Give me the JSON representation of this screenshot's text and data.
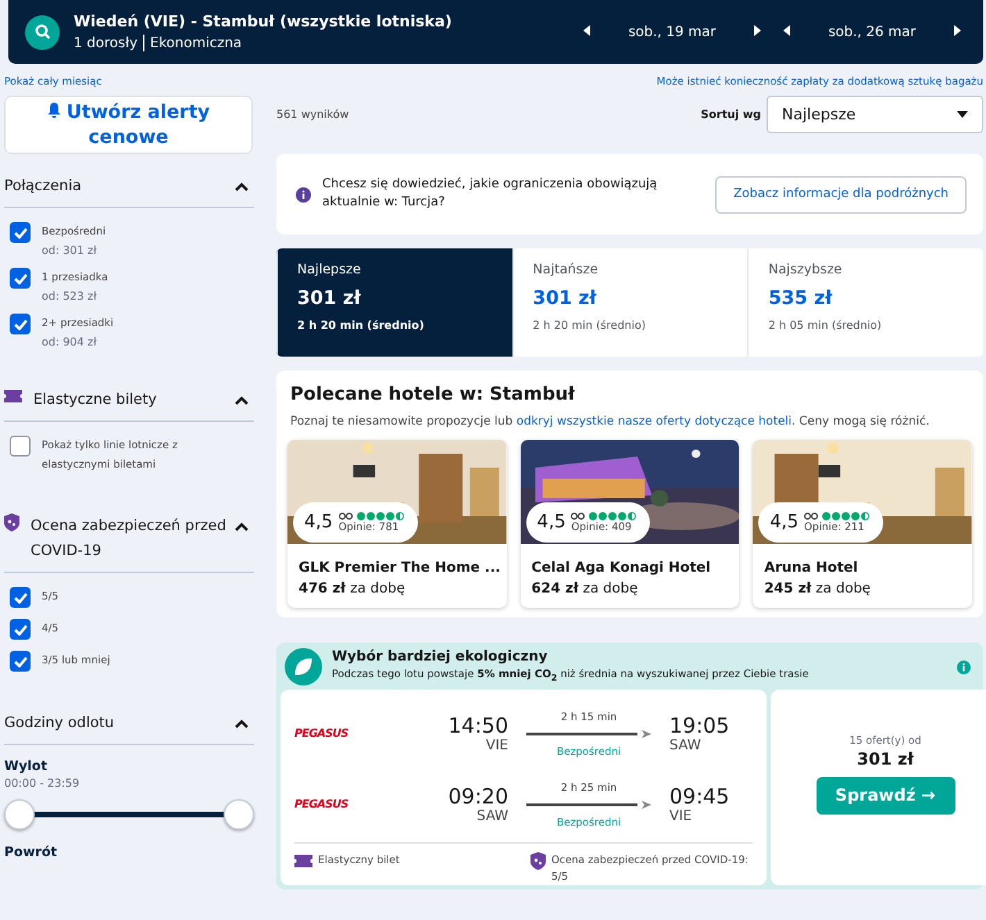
{
  "header": {
    "route": "Wiedeń (VIE) - Stambuł (wszystkie lotniska)",
    "passengers": "1 dorosły",
    "cabin": "Ekonomiczna",
    "dates": [
      {
        "label": "sob., 19 mar"
      },
      {
        "label": "sob., 26 mar"
      }
    ]
  },
  "links": {
    "left": "Pokaż cały miesiąc",
    "right": "Może istnieć konieczność zapłaty za dodatkową sztukę bagażu"
  },
  "alert_button": "Utwórz alerty cenowe",
  "filters": [
    {
      "kind": "checks",
      "title": "Połączenia",
      "items": [
        {
          "label": "Bezpośredni",
          "sub": "od: 301 zł",
          "checked": true
        },
        {
          "label": "1 przesiadka",
          "sub": "od: 523 zł",
          "checked": true
        },
        {
          "label": "2+ przesiadki",
          "sub": "od: 904 zł",
          "checked": true
        }
      ]
    },
    {
      "kind": "checks",
      "title": "Elastyczne bilety",
      "items": [
        {
          "label": "Pokaż tylko linie lotnicze z elastycznymi biletami",
          "checked": false
        }
      ]
    },
    {
      "kind": "checks",
      "title": "Ocena zabezpieczeń przed COVID-19",
      "items": [
        {
          "label": "5/5",
          "checked": true
        },
        {
          "label": "4/5",
          "checked": true
        },
        {
          "label": "3/5 lub mniej",
          "checked": true
        }
      ]
    },
    {
      "kind": "times",
      "title": "Godziny odlotu",
      "groups": [
        {
          "label": "Wylot",
          "range": "00:00 - 23:59",
          "thumbs": [
            {
              "level": 0
            },
            {
              "level": 1
            }
          ]
        },
        {
          "label": "Powrót"
        }
      ]
    }
  ],
  "results_count": "561 wyników",
  "sort": {
    "label": "Sortuj wg",
    "value": "Najlepsze"
  },
  "notice": {
    "text": "Chcesz się dowiedzieć, jakie ograniczenia obowiązują aktualnie w: Turcja?",
    "button": "Zobacz informacje dla podróżnych"
  },
  "tabs": [
    {
      "label": "Najlepsze",
      "price": "301 zł",
      "duration": "2 h 20 min (średnio)",
      "selected": true
    },
    {
      "label": "Najtańsze",
      "price": "301 zł",
      "duration": "2 h 20 min (średnio)",
      "selected": false
    },
    {
      "label": "Najszybsze",
      "price": "535 zł",
      "duration": "2 h 05 min (średnio)",
      "selected": false
    }
  ],
  "hotels": {
    "title": "Polecane hotele w: Stambuł",
    "intro_before": "Poznaj te niesamowite propozycje lub ",
    "intro_link": "odkryj wszystkie nasze oferty dotyczące hoteli",
    "intro_after": ". Ceny mogą się różnić.",
    "items": [
      {
        "rating": "4,5",
        "stars": 4.5,
        "reviews": "Opinie: 781",
        "name": "GLK Premier The Home ...",
        "price": "476 zł",
        "per": "za dobę"
      },
      {
        "rating": "4,5",
        "stars": 4.5,
        "reviews": "Opinie: 409",
        "name": "Celal Aga Konagi Hotel",
        "price": "624 zł",
        "per": "za dobę"
      },
      {
        "rating": "4,5",
        "stars": 4.5,
        "reviews": "Opinie: 211",
        "name": "Aruna Hotel",
        "price": "245 zł",
        "per": "za dobę"
      }
    ]
  },
  "eco": {
    "title": "Wybór bardziej ekologiczny",
    "text": "Podczas tego lotu powstaje **5% mniej CO$_{2}$** niż średnia na wyszukiwanej przez Ciebie trasie"
  },
  "flight": {
    "legs": [
      {
        "airline": "PEGASUS",
        "depart": "14:50",
        "from": "VIE",
        "duration": "2 h 15 min",
        "stops": "Bezpośredni",
        "arrive": "19:05",
        "to": "SAW"
      },
      {
        "airline": "PEGASUS",
        "depart": "09:20",
        "from": "SAW",
        "duration": "2 h 25 min",
        "stops": "Bezpośredni",
        "arrive": "09:45",
        "to": "VIE"
      }
    ],
    "features": [
      {
        "text": "Elastyczny bilet"
      },
      {
        "text": "Ocena zabezpieczeń przed COVID-19: 5/5"
      }
    ],
    "offers": "15 ofert(y) od",
    "price": "301 zł",
    "button": "Sprawdź →"
  }
}
